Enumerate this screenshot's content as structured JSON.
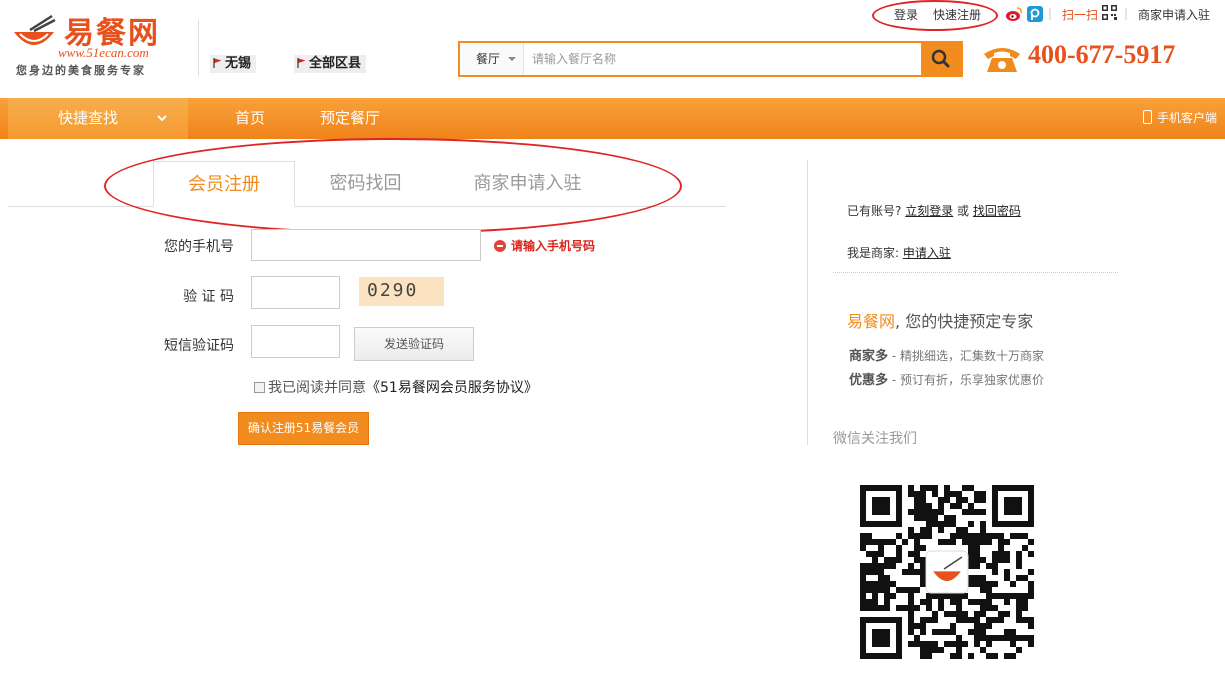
{
  "header": {
    "logo_text": "易餐网",
    "logo_url": "www.51ecan.com",
    "logo_slogan": "您身边的美食服务专家",
    "city": "无锡",
    "district": "全部区县"
  },
  "top_links": {
    "login": "登录",
    "register": "快速注册",
    "scan": "扫一扫",
    "merchant_apply": "商家申请入驻"
  },
  "search": {
    "category": "餐厅",
    "placeholder": "请输入餐厅名称"
  },
  "hotline": "400-677-5917",
  "nav": {
    "quick_find": "快捷查找",
    "home": "首页",
    "reserve": "预定餐厅",
    "mobile_client": "手机客户端"
  },
  "tabs": [
    {
      "label": "会员注册"
    },
    {
      "label": "密码找回"
    },
    {
      "label": "商家申请入驻"
    }
  ],
  "form": {
    "phone_label": "您的手机号",
    "phone_error": "请输入手机号码",
    "captcha_label": "验 证 码",
    "captcha_value": "0290",
    "sms_label": "短信验证码",
    "sms_button": "发送验证码",
    "agree_text": "我已阅读并同意",
    "agree_protocol": "《51易餐网会员服务协议》",
    "submit": "确认注册51易餐会员"
  },
  "sidebar": {
    "have_account": "已有账号?",
    "login_now": "立刻登录",
    "or": "或",
    "find_password": "找回密码",
    "is_merchant": "我是商家:",
    "apply": "申请入驻",
    "brand": "易餐网",
    "slogan": ", 您的快捷预定专家",
    "feature1_title": "商家多",
    "feature1_desc": " - 精挑细选，汇集数十万商家",
    "feature2_title": "优惠多",
    "feature2_desc": " - 预订有折，乐享独家优惠价",
    "wechat": "微信关注我们"
  },
  "colors": {
    "accent": "#f28c1e",
    "brand": "#e8501c",
    "error": "#d9251c",
    "highlight_ellipse": "#e02424"
  }
}
